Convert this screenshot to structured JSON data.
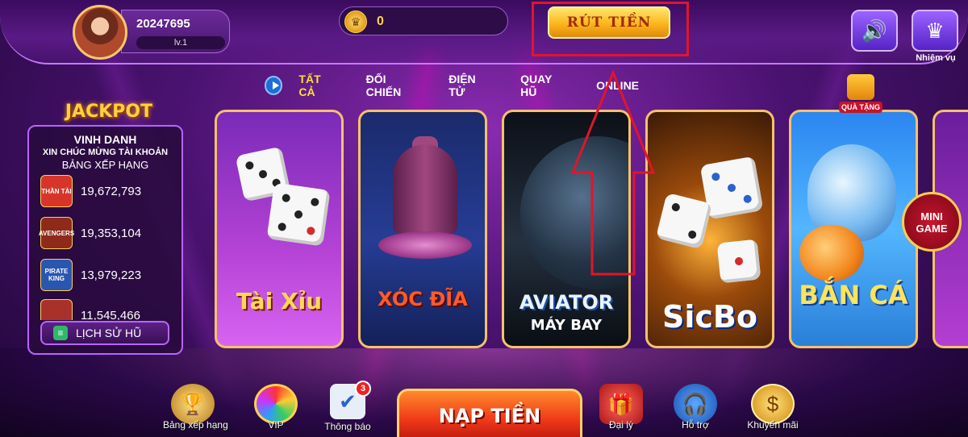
{
  "user": {
    "id": "20247695",
    "level": "lv.1"
  },
  "balance": {
    "value": "0"
  },
  "header": {
    "withdraw_label": "RÚT TIỀN",
    "mission_label": "Nhiệm vụ"
  },
  "tabs": [
    {
      "label": "TẤT CẢ",
      "active": true
    },
    {
      "label": "ĐỐI CHIẾN",
      "active": false
    },
    {
      "label": "ĐIỆN TỬ",
      "active": false
    },
    {
      "label": "QUAY HŨ",
      "active": false
    },
    {
      "label": "ONLINE",
      "active": false
    }
  ],
  "jackpot": {
    "title": "JACKPOT",
    "heading": "VINH DANH",
    "congrats": "XIN CHÚC MỪNG TÀI KHOẢN",
    "ranking": "BẢNG XẾP HẠNG",
    "entries": [
      {
        "game": "THẦN TÀI",
        "amount": "19,672,793",
        "color": "#d8352a"
      },
      {
        "game": "AVENGERS",
        "amount": "19,353,104",
        "color": "#8e2a1a"
      },
      {
        "game": "PIRATE KING",
        "amount": "13,979,223",
        "color": "#2a56b0"
      },
      {
        "game": "",
        "amount": "11,545,466",
        "color": "#a8322a"
      }
    ],
    "history_label": "LỊCH SỬ HŨ"
  },
  "games": [
    {
      "name": "Tài Xỉu"
    },
    {
      "name": "XÓC ĐĨA"
    },
    {
      "name": "AVIATOR",
      "subtitle": "MÁY BAY"
    },
    {
      "name": "SicBo"
    },
    {
      "name": "BẮN CÁ"
    }
  ],
  "side": {
    "gift_label": "QUÀ TẶNG",
    "minigame_line1": "MINI",
    "minigame_line2": "GAME"
  },
  "bottom_nav": {
    "ranking": "Bảng xếp hạng",
    "vip": "VIP",
    "news": "Thông báo",
    "news_badge": "3",
    "deposit": "NẠP TIỀN",
    "agent": "Đại lý",
    "support": "Hỗ trợ",
    "promo": "Khuyến mãi"
  },
  "colors": {
    "accent_gold": "#ffd24a",
    "highlight_red": "#e0152b",
    "active_tab": "#ffde3a"
  }
}
